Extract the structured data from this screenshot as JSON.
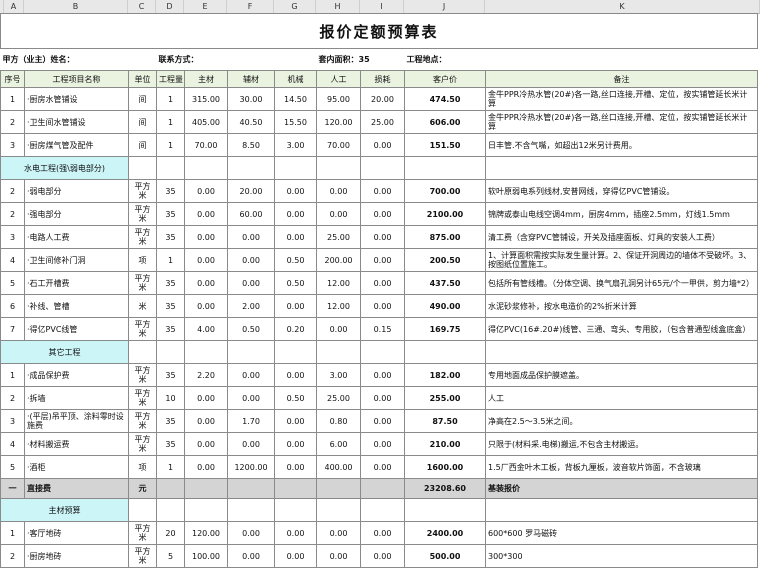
{
  "column_letters": [
    "A",
    "B",
    "C",
    "D",
    "E",
    "F",
    "G",
    "H",
    "I",
    "J",
    "K"
  ],
  "title": "报价定额预算表",
  "info": {
    "owner_label": "甲方（业主）姓名：",
    "contact_label": "联系方式：",
    "area_label": "套内面积：35",
    "site_label": "工程地点："
  },
  "headers": [
    "序号",
    "工程项目名称",
    "单位",
    "工程量",
    "主材",
    "辅材",
    "机械",
    "人工",
    "损耗",
    "客户价",
    "备注"
  ],
  "rows_a": [
    {
      "no": "1",
      "name": "·厨房水管铺设",
      "unit": "间",
      "qty": "1",
      "main": "315.00",
      "aux": "30.00",
      "mach": "14.50",
      "labor": "95.00",
      "loss": "20.00",
      "price": "474.50",
      "note": "金牛PPR冷热水管(20#)各一路,丝口连接,开槽、定位，按实铺管延长米计算"
    },
    {
      "no": "2",
      "name": "·卫生间水管铺设",
      "unit": "间",
      "qty": "1",
      "main": "405.00",
      "aux": "40.50",
      "mach": "15.50",
      "labor": "120.00",
      "loss": "25.00",
      "price": "606.00",
      "note": "金牛PPR冷热水管(20#)各一路,丝口连接,开槽、定位，按实铺管延长米计算"
    },
    {
      "no": "3",
      "name": "·厨房煤气管及配件",
      "unit": "间",
      "qty": "1",
      "main": "70.00",
      "aux": "8.50",
      "mach": "3.00",
      "labor": "70.00",
      "loss": "0.00",
      "price": "151.50",
      "note": "日丰管.不含气嘴，如超出12米另计费用。"
    }
  ],
  "section_water": "水电工程(强\\弱电部分)",
  "rows_b": [
    {
      "no": "2",
      "name": "·弱电部分",
      "unit": "平方米",
      "qty": "35",
      "main": "0.00",
      "aux": "20.00",
      "mach": "0.00",
      "labor": "0.00",
      "loss": "0.00",
      "price": "700.00",
      "note": "软叶原弱电系列线材,安普网线，穿得亿PVC管铺设。"
    },
    {
      "no": "2",
      "name": "·强电部分",
      "unit": "平方米",
      "qty": "35",
      "main": "0.00",
      "aux": "60.00",
      "mach": "0.00",
      "labor": "0.00",
      "loss": "0.00",
      "price": "2100.00",
      "note": "锦牌或泰山电线空调4mm，厨房4mm，插座2.5mm，灯线1.5mm"
    },
    {
      "no": "3",
      "name": "·电路人工费",
      "unit": "平方米",
      "qty": "35",
      "main": "0.00",
      "aux": "0.00",
      "mach": "0.00",
      "labor": "25.00",
      "loss": "0.00",
      "price": "875.00",
      "note": "清工费（含穿PVC管铺设，开关及插座面板、灯具的安装人工费）"
    },
    {
      "no": "4",
      "name": "·卫生间修补门洞",
      "unit": "项",
      "qty": "1",
      "main": "0.00",
      "aux": "0.00",
      "mach": "0.50",
      "labor": "200.00",
      "loss": "0.00",
      "price": "200.50",
      "note": "1、计算面积需按实际发生量计算。2、保证开洞周边的墙体不受破坏。3、按图纸位置施工。"
    },
    {
      "no": "5",
      "name": "·石工开槽费",
      "unit": "平方米",
      "qty": "35",
      "main": "0.00",
      "aux": "0.00",
      "mach": "0.50",
      "labor": "12.00",
      "loss": "0.00",
      "price": "437.50",
      "note": "包括所有管线槽。（分体空调、换气扇孔洞另计65元/个一甲供，剪力墙*2）"
    },
    {
      "no": "6",
      "name": "·补线、管槽",
      "unit": "米",
      "qty": "35",
      "main": "0.00",
      "aux": "2.00",
      "mach": "0.00",
      "labor": "12.00",
      "loss": "0.00",
      "price": "490.00",
      "note": "水泥砂浆修补，按水电造价的2%折米计算"
    },
    {
      "no": "7",
      "name": "·得亿PVC线管",
      "unit": "平方米",
      "qty": "35",
      "main": "4.00",
      "aux": "0.50",
      "mach": "0.20",
      "labor": "0.00",
      "loss": "0.15",
      "price": "169.75",
      "note": "得亿PVC(16#.20#)线管、三通、弯头、专用胶，（包含普通型线盒底盒）"
    }
  ],
  "section_other": "其它工程",
  "rows_c": [
    {
      "no": "1",
      "name": "·成品保护费",
      "unit": "平方米",
      "qty": "35",
      "main": "2.20",
      "aux": "0.00",
      "mach": "0.00",
      "labor": "3.00",
      "loss": "0.00",
      "price": "182.00",
      "note": "专用地面成品保护膜遮盖。"
    },
    {
      "no": "2",
      "name": "·拆墙",
      "unit": "平方米",
      "qty": "10",
      "main": "0.00",
      "aux": "0.00",
      "mach": "0.50",
      "labor": "25.00",
      "loss": "0.00",
      "price": "255.00",
      "note": "人工"
    },
    {
      "no": "3",
      "name": "·(平层)吊平顶、涂料零时设施费",
      "unit": "平方米",
      "qty": "35",
      "main": "0.00",
      "aux": "1.70",
      "mach": "0.00",
      "labor": "0.80",
      "loss": "0.00",
      "price": "87.50",
      "note": "净高在2.5～3.5米之间。"
    },
    {
      "no": "4",
      "name": "·材料搬运费",
      "unit": "平方米",
      "qty": "35",
      "main": "0.00",
      "aux": "0.00",
      "mach": "0.00",
      "labor": "6.00",
      "loss": "0.00",
      "price": "210.00",
      "note": "只限于(材料采.电梯)搬运,不包含主材搬运。"
    },
    {
      "no": "5",
      "name": "·酒柜",
      "unit": "项",
      "qty": "1",
      "main": "0.00",
      "aux": "1200.00",
      "mach": "0.00",
      "labor": "400.00",
      "loss": "0.00",
      "price": "1600.00",
      "note": "1.5厂西金叶木工板，背板九厘板，波音软片饰面，不含玻璃"
    }
  ],
  "total": {
    "no": "一",
    "name": "直接费",
    "unit": "元",
    "price": "23208.60",
    "note": "基装报价"
  },
  "section_main": "主材预算",
  "rows_d": [
    {
      "no": "1",
      "name": "·客厅地砖",
      "unit": "平方米",
      "qty": "20",
      "main": "120.00",
      "aux": "0.00",
      "mach": "0.00",
      "labor": "0.00",
      "loss": "0.00",
      "price": "2400.00",
      "note": "600*600 罗马磁砖"
    },
    {
      "no": "2",
      "name": "·厨房地砖",
      "unit": "平方米",
      "qty": "5",
      "main": "100.00",
      "aux": "0.00",
      "mach": "0.00",
      "labor": "0.00",
      "loss": "0.00",
      "price": "500.00",
      "note": "300*300"
    }
  ],
  "colors": {
    "header_bg": "#eaf3e0",
    "section_bg": "#ccf5f8",
    "total_bg": "#d4d4d4",
    "price_highlight": "#ffc000"
  }
}
